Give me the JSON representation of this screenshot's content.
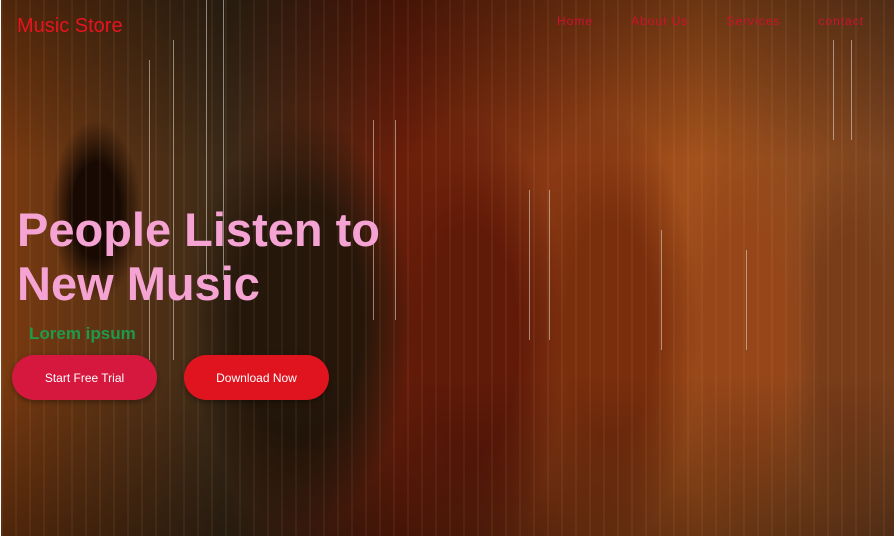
{
  "header": {
    "brand": "Music Store",
    "nav": {
      "home": "Home",
      "about": "About Us",
      "services": "Services",
      "contact": "contact"
    }
  },
  "hero": {
    "headline": "People Listen to New Music",
    "subtitle": "Lorem ipsum",
    "buttons": {
      "trial": "Start Free Trial",
      "download": "Download Now"
    },
    "background": "violins-photo"
  },
  "colors": {
    "brand": "#e8131f",
    "nav": "#cf1030",
    "headline": "#f5a3d2",
    "subtitle": "#1e9a4a",
    "trial_button": "#d6173e",
    "download_button": "#e0141f"
  }
}
